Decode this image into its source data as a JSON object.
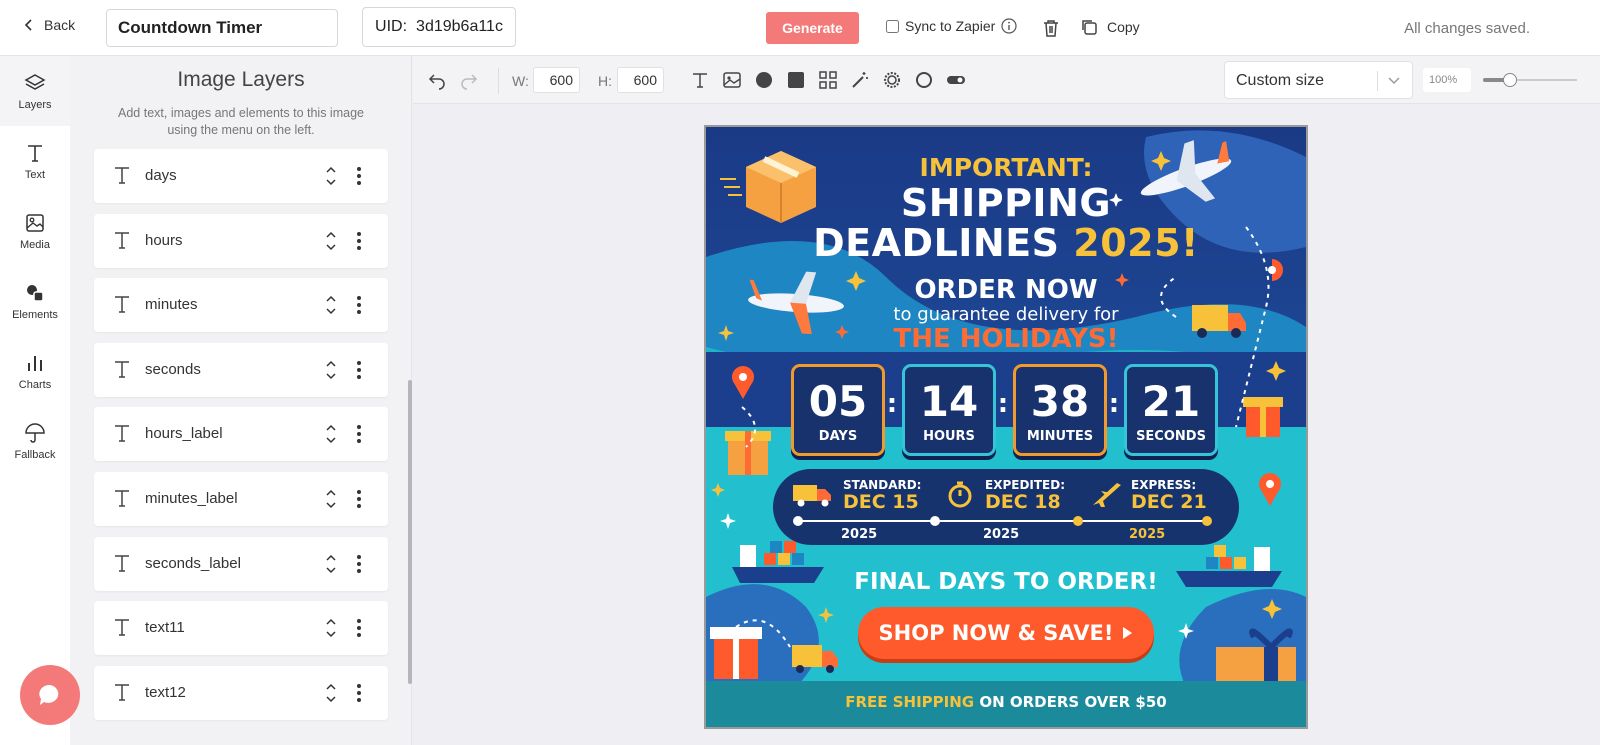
{
  "header": {
    "back_label": "Back",
    "title_value": "Countdown Timer",
    "uid_label": "UID:",
    "uid_value": "3d19b6a11c",
    "generate_label": "Generate",
    "sync_label": "Sync to Zapier",
    "copy_label": "Copy",
    "status": "All changes saved."
  },
  "rail": {
    "items": [
      {
        "label": "Layers",
        "icon": "layers-icon"
      },
      {
        "label": "Text",
        "icon": "text-icon"
      },
      {
        "label": "Media",
        "icon": "image-icon"
      },
      {
        "label": "Elements",
        "icon": "shapes-icon"
      },
      {
        "label": "Charts",
        "icon": "bar-chart-icon"
      },
      {
        "label": "Fallback",
        "icon": "umbrella-icon"
      }
    ]
  },
  "panel": {
    "title": "Image Layers",
    "description": "Add text, images and elements to this image using the menu on the left.",
    "layers": [
      {
        "name": "days"
      },
      {
        "name": "hours"
      },
      {
        "name": "minutes"
      },
      {
        "name": "seconds"
      },
      {
        "name": "hours_label"
      },
      {
        "name": "minutes_label"
      },
      {
        "name": "seconds_label"
      },
      {
        "name": "text11"
      },
      {
        "name": "text12"
      }
    ]
  },
  "toolbar": {
    "width_label": "W:",
    "width_value": "600",
    "height_label": "H:",
    "height_value": "600",
    "size_preset": "Custom size",
    "zoom": "100%"
  },
  "poster": {
    "important": "IMPORTANT:",
    "headline_1": "SHIPPING",
    "headline_2": "DEADLINES",
    "headline_year": "2025!",
    "order_now": "ORDER NOW",
    "guarantee": "to guarantee delivery for",
    "holidays": "THE HOLIDAYS!",
    "countdown": [
      {
        "value": "05",
        "label": "DAYS"
      },
      {
        "value": "14",
        "label": "HOURS"
      },
      {
        "value": "38",
        "label": "MINUTES"
      },
      {
        "value": "21",
        "label": "SECONDS"
      }
    ],
    "separator": ":",
    "shipping": [
      {
        "label": "STANDARD:",
        "date": "DEC 15",
        "year": "2025"
      },
      {
        "label": "EXPEDITED:",
        "date": "DEC 18",
        "year": "2025"
      },
      {
        "label": "EXPRESS:",
        "date": "DEC 21",
        "year": "2025"
      }
    ],
    "final_days": "FINAL DAYS TO ORDER!",
    "cta": "SHOP NOW & SAVE!",
    "footer_free": "FREE SHIPPING",
    "footer_rest": " ON ORDERS OVER $50"
  },
  "colors": {
    "accent": "#f47a7a",
    "poster_navy": "#1d3f8a",
    "poster_teal": "#1fb3c7",
    "poster_gold": "#f7c23a",
    "poster_orange": "#ff5a2c"
  }
}
